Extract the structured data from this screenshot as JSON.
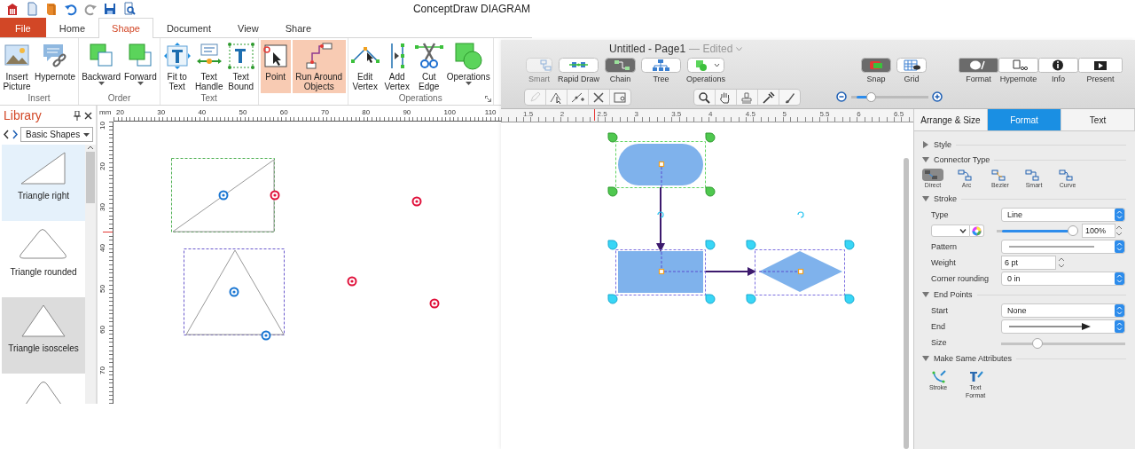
{
  "windows_app": {
    "title": "ConceptDraw DIAGRAM",
    "tabs": [
      {
        "label": "File",
        "kind": "file",
        "selected": false
      },
      {
        "label": "Home",
        "kind": "tab",
        "selected": false
      },
      {
        "label": "Shape",
        "kind": "tab",
        "selected": true
      },
      {
        "label": "Document",
        "kind": "tab",
        "selected": false
      },
      {
        "label": "View",
        "kind": "tab",
        "selected": false
      },
      {
        "label": "Share",
        "kind": "tab",
        "selected": false
      }
    ],
    "ribbon_groups": [
      {
        "label": "Insert",
        "launcher": false,
        "buttons": [
          {
            "label": "Insert Picture",
            "selected": false,
            "dropdown": false
          },
          {
            "label": "Hypernote",
            "selected": false,
            "dropdown": false
          }
        ]
      },
      {
        "label": "Order",
        "launcher": false,
        "buttons": [
          {
            "label": "Backward",
            "selected": false,
            "dropdown": true
          },
          {
            "label": "Forward",
            "selected": false,
            "dropdown": true
          }
        ]
      },
      {
        "label": "Text",
        "launcher": false,
        "buttons": [
          {
            "label": "Fit to Text",
            "selected": false,
            "dropdown": false
          },
          {
            "label": "Text Handle",
            "selected": false,
            "dropdown": false
          },
          {
            "label": "Text Bound",
            "selected": false,
            "dropdown": false
          }
        ]
      },
      {
        "launcher": false,
        "buttons": [
          {
            "label": "Point",
            "selected": true,
            "dropdown": false
          },
          {
            "label": "Run Around Objects",
            "selected": true,
            "dropdown": false
          }
        ]
      },
      {
        "label": "Operations",
        "launcher": true,
        "buttons": [
          {
            "label": "Edit Vertex",
            "selected": false,
            "dropdown": false
          },
          {
            "label": "Add Vertex",
            "selected": false,
            "dropdown": false
          },
          {
            "label": "Cut Edge",
            "selected": false,
            "dropdown": false
          },
          {
            "label": "Operations",
            "selected": false,
            "dropdown": true
          }
        ]
      }
    ],
    "library": {
      "title": "Library",
      "category": "Basic Shapes",
      "items": [
        {
          "label": "Triangle right",
          "selected": true,
          "hovered": false
        },
        {
          "label": "Triangle rounded",
          "selected": false,
          "hovered": false
        },
        {
          "label": "Triangle isosceles",
          "selected": false,
          "hovered": true
        },
        {
          "selected": false,
          "hovered": false
        }
      ]
    },
    "canvas": {
      "top_ruler": [
        "mm",
        "20",
        "30",
        "40",
        "50",
        "60",
        "70",
        "80",
        "90",
        "100",
        "110"
      ],
      "left_ruler": [
        "10",
        "20",
        "30",
        "40",
        "50",
        "60",
        "70"
      ]
    }
  },
  "mac_app": {
    "title": "Untitled - Page1",
    "status": "— Edited",
    "toolbar": [
      {
        "label": "Smart",
        "selected": false,
        "disabled": true
      },
      {
        "label": "Rapid Draw",
        "selected": false,
        "disabled": false
      },
      {
        "label": "Chain",
        "selected": true,
        "disabled": false
      },
      {
        "label": "Tree",
        "selected": false,
        "disabled": false
      },
      {
        "label": "Operations",
        "selected": false,
        "disabled": false
      }
    ],
    "toggles": [
      {
        "label": "Snap",
        "selected": true
      },
      {
        "label": "Grid",
        "selected": false
      }
    ],
    "inspectors": [
      {
        "label": "Format",
        "selected": true
      },
      {
        "label": "Hypernote",
        "selected": false
      },
      {
        "label": "Info",
        "selected": false
      },
      {
        "label": "Present",
        "selected": false
      }
    ],
    "zoom": {
      "level": 0.23
    },
    "ruler": [
      "1.5",
      "2",
      "2.5",
      "3",
      "3.5",
      "4",
      "4.5",
      "5",
      "5.5",
      "6",
      "6.5"
    ],
    "panel": {
      "tabs": [
        {
          "label": "Arrange & Size",
          "selected": false
        },
        {
          "label": "Format",
          "selected": true
        },
        {
          "label": "Text",
          "selected": false
        }
      ],
      "sections": [
        {
          "title": "Style",
          "expanded": false
        },
        {
          "title": "Connector Type",
          "expanded": true,
          "kind": "connectors",
          "items": [
            {
              "label": "Direct",
              "selected": true
            },
            {
              "label": "Arc",
              "selected": false
            },
            {
              "label": "Bezier",
              "selected": false
            },
            {
              "label": "Smart",
              "selected": false
            },
            {
              "label": "Curve",
              "selected": false
            }
          ]
        },
        {
          "title": "Stroke",
          "expanded": true,
          "kind": "rows",
          "rows": [
            {
              "kind": "select",
              "label": "Type",
              "value": "Line"
            },
            {
              "kind": "color",
              "level": 1,
              "value": "100%"
            },
            {
              "kind": "line-select",
              "label": "Pattern",
              "arrow": false
            },
            {
              "kind": "stepper",
              "label": "Weight",
              "value": "6 pt"
            },
            {
              "kind": "select",
              "label": "Corner rounding",
              "value": "0 in"
            }
          ]
        },
        {
          "title": "End Points",
          "expanded": true,
          "kind": "rows",
          "rows": [
            {
              "kind": "select",
              "label": "Start",
              "value": "None"
            },
            {
              "kind": "line-select",
              "label": "End",
              "arrow": true
            },
            {
              "kind": "slider",
              "label": "Size",
              "level": 0.27
            }
          ]
        },
        {
          "title": "Make Same Attributes",
          "expanded": true,
          "kind": "buttons",
          "items": [
            {
              "label": "Stroke"
            },
            {
              "label": "Text Format"
            }
          ]
        }
      ]
    }
  }
}
